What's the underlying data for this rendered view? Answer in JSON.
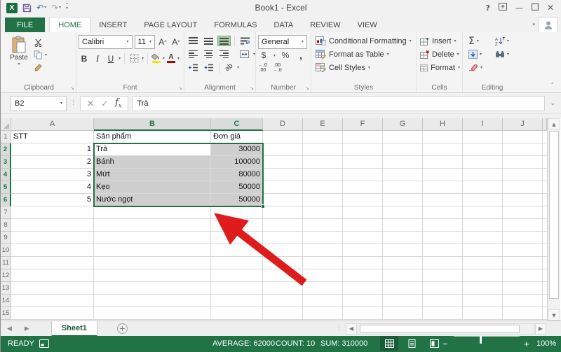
{
  "title_bar": {
    "title": "Book1 - Excel"
  },
  "ribbon_tabs": [
    {
      "label": "FILE",
      "style": "file"
    },
    {
      "label": "HOME",
      "style": "active"
    },
    {
      "label": "INSERT",
      "style": ""
    },
    {
      "label": "PAGE LAYOUT",
      "style": ""
    },
    {
      "label": "FORMULAS",
      "style": ""
    },
    {
      "label": "DATA",
      "style": ""
    },
    {
      "label": "REVIEW",
      "style": ""
    },
    {
      "label": "VIEW",
      "style": ""
    }
  ],
  "ribbon": {
    "clipboard": {
      "label": "Clipboard",
      "paste": "Paste"
    },
    "font": {
      "label": "Font",
      "family": "Calibri",
      "size": "11"
    },
    "alignment": {
      "label": "Alignment"
    },
    "number": {
      "label": "Number",
      "format": "General"
    },
    "styles": {
      "label": "Styles",
      "items": [
        "Conditional Formatting",
        "Format as Table",
        "Cell Styles"
      ]
    },
    "cells": {
      "label": "Cells",
      "items": [
        "Insert",
        "Delete",
        "Format"
      ]
    },
    "editing": {
      "label": "Editing"
    }
  },
  "formula_bar": {
    "name_box": "B2",
    "value": "Trà"
  },
  "grid": {
    "col_headers": [
      "A",
      "B",
      "C",
      "D",
      "E",
      "F",
      "G",
      "H",
      "I",
      "J"
    ],
    "row_count": 15,
    "selected_cols": [
      "B",
      "C"
    ],
    "selected_rows": [
      2,
      3,
      4,
      5,
      6
    ],
    "active_cell": "B2",
    "selection_range": "B2:C6",
    "rows": [
      {
        "A": "STT",
        "B": "Sản phẩm",
        "C": "Đơn giá"
      },
      {
        "A": "1",
        "B": "Trà",
        "C": "30000"
      },
      {
        "A": "2",
        "B": "Bánh",
        "C": "100000"
      },
      {
        "A": "3",
        "B": "Mứt",
        "C": "80000"
      },
      {
        "A": "4",
        "B": "Kẹo",
        "C": "50000"
      },
      {
        "A": "5",
        "B": "Nước ngọt",
        "C": "50000"
      }
    ]
  },
  "sheet_tabs": {
    "active": "Sheet1"
  },
  "status_bar": {
    "mode": "READY",
    "average": "AVERAGE: 62000",
    "count": "COUNT: 10",
    "sum": "SUM: 310000",
    "zoom_level": "100%"
  },
  "colors": {
    "accent_green": "#217346",
    "selection_fill": "#cfcfcf",
    "arrow_red": "#e01b1b"
  }
}
